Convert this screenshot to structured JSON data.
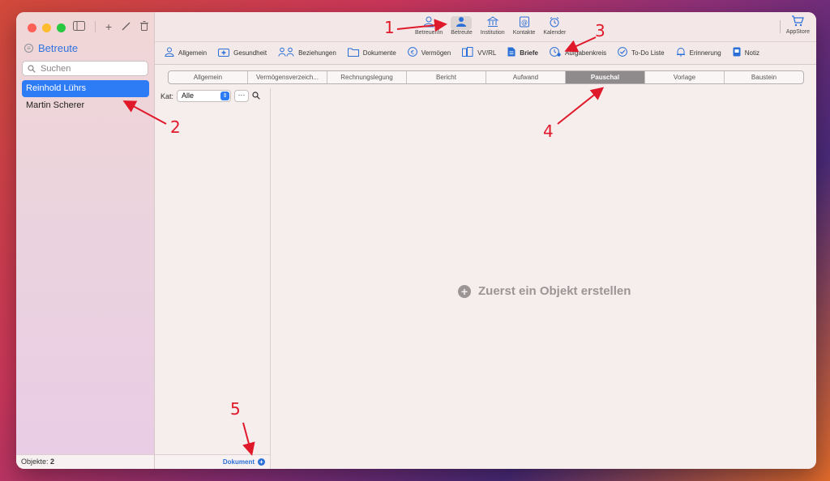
{
  "sidebar": {
    "title": "Betreute",
    "search_placeholder": "Suchen",
    "items": [
      {
        "label": "Reinhold Lührs",
        "selected": true
      },
      {
        "label": "Martin Scherer",
        "selected": false
      }
    ],
    "footer_label": "Objekte:",
    "footer_count": "2"
  },
  "topnav": {
    "items": [
      {
        "label": "Betreuer/in",
        "icon": "person-outline-icon"
      },
      {
        "label": "Betreute",
        "icon": "person-filled-icon",
        "active": true
      },
      {
        "label": "Institution",
        "icon": "bank-icon"
      },
      {
        "label": "Kontakte",
        "icon": "at-book-icon"
      },
      {
        "label": "Kalender",
        "icon": "alarm-icon"
      }
    ],
    "appstore_label": "AppStore"
  },
  "categories": [
    {
      "label": "Allgemein",
      "icon": "person-icon"
    },
    {
      "label": "Gesundheit",
      "icon": "medkit-icon"
    },
    {
      "label": "Beziehungen",
      "icon": "people-icon"
    },
    {
      "label": "Dokumente",
      "icon": "folder-icon"
    },
    {
      "label": "Vermögen",
      "icon": "euro-icon"
    },
    {
      "label": "VV/RL",
      "icon": "building-icon"
    },
    {
      "label": "Briefe",
      "icon": "document-icon",
      "active": true
    },
    {
      "label": "Aufgabenkreis",
      "icon": "clock-icon"
    },
    {
      "label": "To-Do Liste",
      "icon": "check-icon"
    },
    {
      "label": "Erinnerung",
      "icon": "bell-icon"
    },
    {
      "label": "Notiz",
      "icon": "note-icon"
    }
  ],
  "segments": [
    {
      "label": "Allgemein"
    },
    {
      "label": "Vermögensverzeich..."
    },
    {
      "label": "Rechnungslegung"
    },
    {
      "label": "Bericht"
    },
    {
      "label": "Aufwand"
    },
    {
      "label": "Pauschal",
      "active": true
    },
    {
      "label": "Vorlage"
    },
    {
      "label": "Baustein"
    }
  ],
  "filter": {
    "label": "Kat:",
    "selected": "Alle",
    "more_label": "···"
  },
  "mid_footer_label": "Dokument",
  "empty_state": "Zuerst ein Objekt erstellen",
  "annotations": [
    "1",
    "2",
    "3",
    "4",
    "5"
  ],
  "colors": {
    "accent": "#2d7cf6",
    "annotation": "#e0192a"
  }
}
